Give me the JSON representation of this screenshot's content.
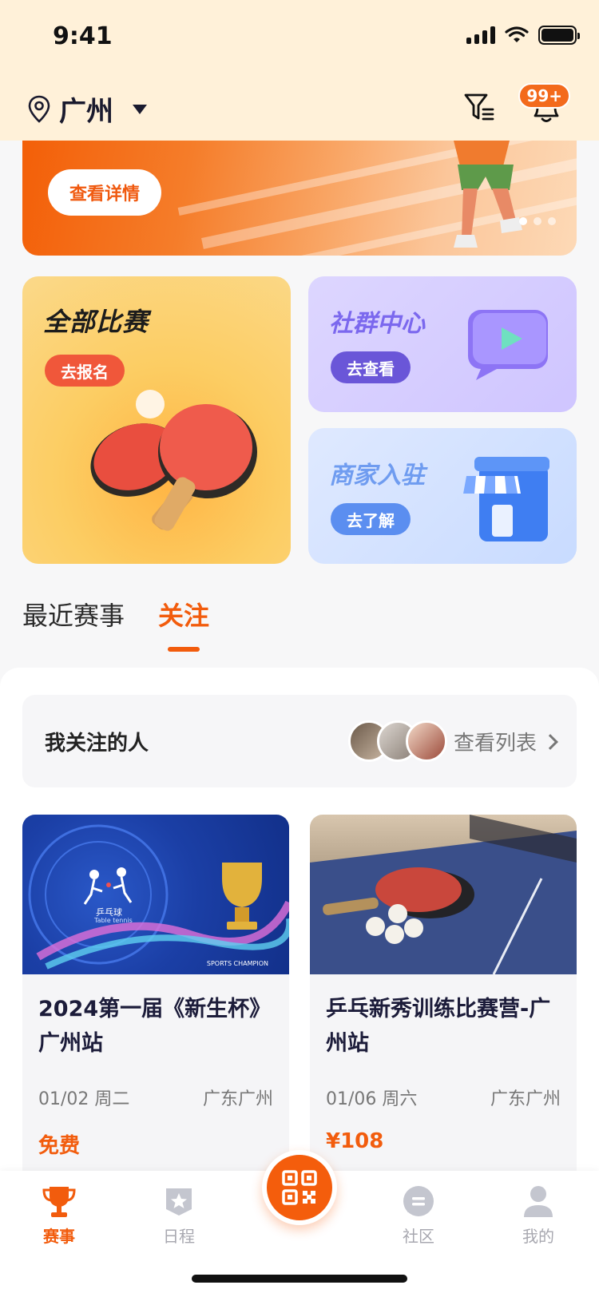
{
  "status": {
    "time": "9:41"
  },
  "header": {
    "city": "广州",
    "notification_count": "99+"
  },
  "banner": {
    "button_label": "查看详情"
  },
  "cards": {
    "all_matches": {
      "title": "全部比赛",
      "button": "去报名"
    },
    "community": {
      "title": "社群中心",
      "button": "去查看"
    },
    "merchant": {
      "title": "商家入驻",
      "button": "去了解"
    }
  },
  "tabs": [
    {
      "label": "最近赛事",
      "active": false
    },
    {
      "label": "关注",
      "active": true
    }
  ],
  "following": {
    "label": "我关注的人",
    "view_list": "查看列表"
  },
  "events": [
    {
      "title": "2024第一届《新生杯》广州站",
      "date": "01/02 周二",
      "place": "广东广州",
      "price": "免费",
      "img_text": "乒乓球",
      "img_subtext": "Table tennis",
      "img_caption": "SPORTS CHAMPION"
    },
    {
      "title": "乒乓新秀训练比赛营-广州站",
      "date": "01/06 周六",
      "place": "广东广州",
      "price": "¥108"
    }
  ],
  "nav": [
    {
      "label": "赛事",
      "icon": "trophy-icon",
      "active": true
    },
    {
      "label": "日程",
      "icon": "star-badge-icon",
      "active": false
    },
    {
      "label": "社区",
      "icon": "chat-icon",
      "active": false
    },
    {
      "label": "我的",
      "icon": "person-icon",
      "active": false
    }
  ],
  "colors": {
    "accent": "#f25c0d",
    "header_bg": "#fff1d9"
  }
}
